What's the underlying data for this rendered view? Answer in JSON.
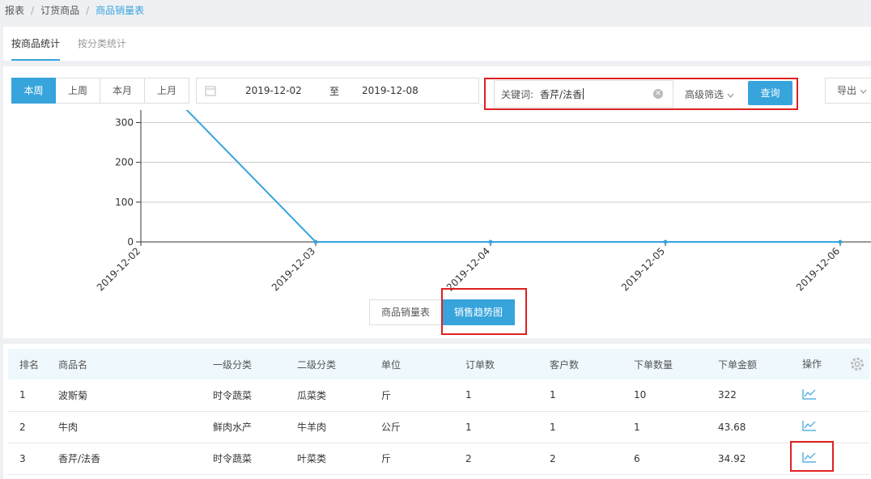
{
  "breadcrumb": {
    "items": [
      "报表",
      "订货商品"
    ],
    "current": "商品销量表"
  },
  "tabs": {
    "by_product": "按商品统计",
    "by_category": "按分类统计"
  },
  "period": {
    "this_week": "本周",
    "last_week": "上周",
    "this_month": "本月",
    "last_month": "上月"
  },
  "date": {
    "start": "2019-12-02",
    "to": "至",
    "end": "2019-12-08"
  },
  "search": {
    "label": "关键词:",
    "value": "香芹/法香",
    "advanced": "高级筛选",
    "query": "查询"
  },
  "export": "导出",
  "view": {
    "table": "商品销量表",
    "trend": "销售趋势图"
  },
  "chart_data": {
    "type": "line",
    "x": [
      "2019-12-02",
      "2019-12-03",
      "2019-12-04",
      "2019-12-05",
      "2019-12-06"
    ],
    "values": [
      450,
      0,
      0,
      0,
      0
    ],
    "y_ticks": [
      "0",
      "100",
      "200",
      "300"
    ],
    "ylim": [
      0,
      360
    ],
    "grid": true,
    "color": "#37a4dc"
  },
  "table": {
    "headers": [
      "排名",
      "商品名",
      "一级分类",
      "二级分类",
      "单位",
      "订单数",
      "客户数",
      "下单数量",
      "下单金额",
      "操作"
    ],
    "rows": [
      [
        "1",
        "波斯菊",
        "时令蔬菜",
        "瓜菜类",
        "斤",
        "1",
        "1",
        "10",
        "322"
      ],
      [
        "2",
        "牛肉",
        "鲜肉水产",
        "牛羊肉",
        "公斤",
        "1",
        "1",
        "1",
        "43.68"
      ],
      [
        "3",
        "香芹/法香",
        "时令蔬菜",
        "叶菜类",
        "斤",
        "2",
        "2",
        "6",
        "34.92"
      ]
    ]
  },
  "icons": {
    "settings": "gear-icon",
    "calendar": "calendar-icon",
    "trend": "trend-chart-icon"
  }
}
